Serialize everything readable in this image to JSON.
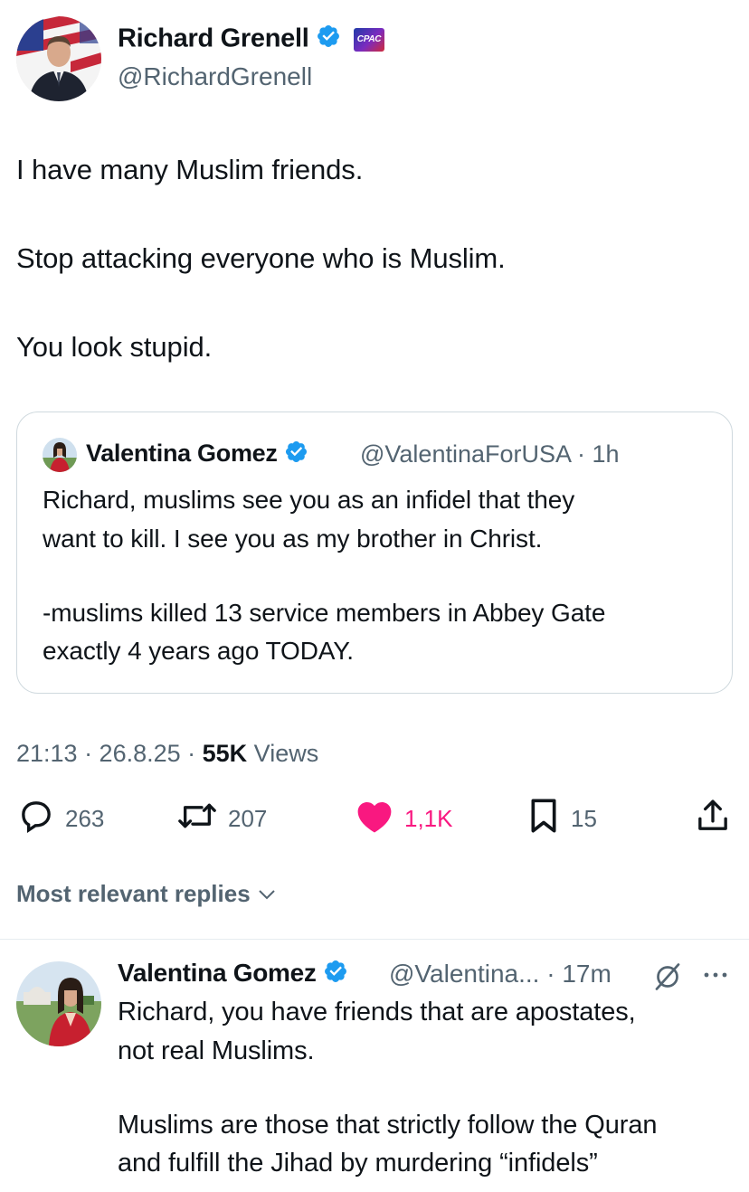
{
  "colors": {
    "text": "#0f1419",
    "secondary": "#536471",
    "verified": "#1d9bf0",
    "like": "#f91880",
    "border": "#cfd9de"
  },
  "tweet": {
    "author_name": "Richard Grenell",
    "author_handle": "@RichardGrenell",
    "badge_text": "CPAC",
    "lines": [
      "I have many Muslim friends.",
      "Stop attacking everyone who is Muslim.",
      "You look stupid."
    ],
    "quote": {
      "author_name": "Valentina Gomez",
      "author_handle": "@ValentinaForUSA · 1h",
      "lines": [
        "Richard, muslims see you as an infidel that they",
        "want to kill. I see you as my brother in Christ.",
        "-muslims killed 13 service members in Abbey Gate",
        "exactly 4 years ago TODAY."
      ]
    },
    "meta": {
      "time_date": "21:13 · 26.8.25 · ",
      "views_count": "55K",
      "views_label": " Views"
    },
    "actions": {
      "replies": "263",
      "reposts": "207",
      "likes": "1,1K",
      "bookmarks": "15"
    }
  },
  "replies_section": {
    "header": "Most relevant replies"
  },
  "reply": {
    "author_name": "Valentina Gomez",
    "author_handle": "@Valentina... · 17m",
    "lines": [
      "Richard, you have friends that are apostates,",
      "not real Muslims.",
      "Muslims are those that strictly follow the Quran",
      "and fulfill the Jihad by murdering “infidels”"
    ]
  }
}
